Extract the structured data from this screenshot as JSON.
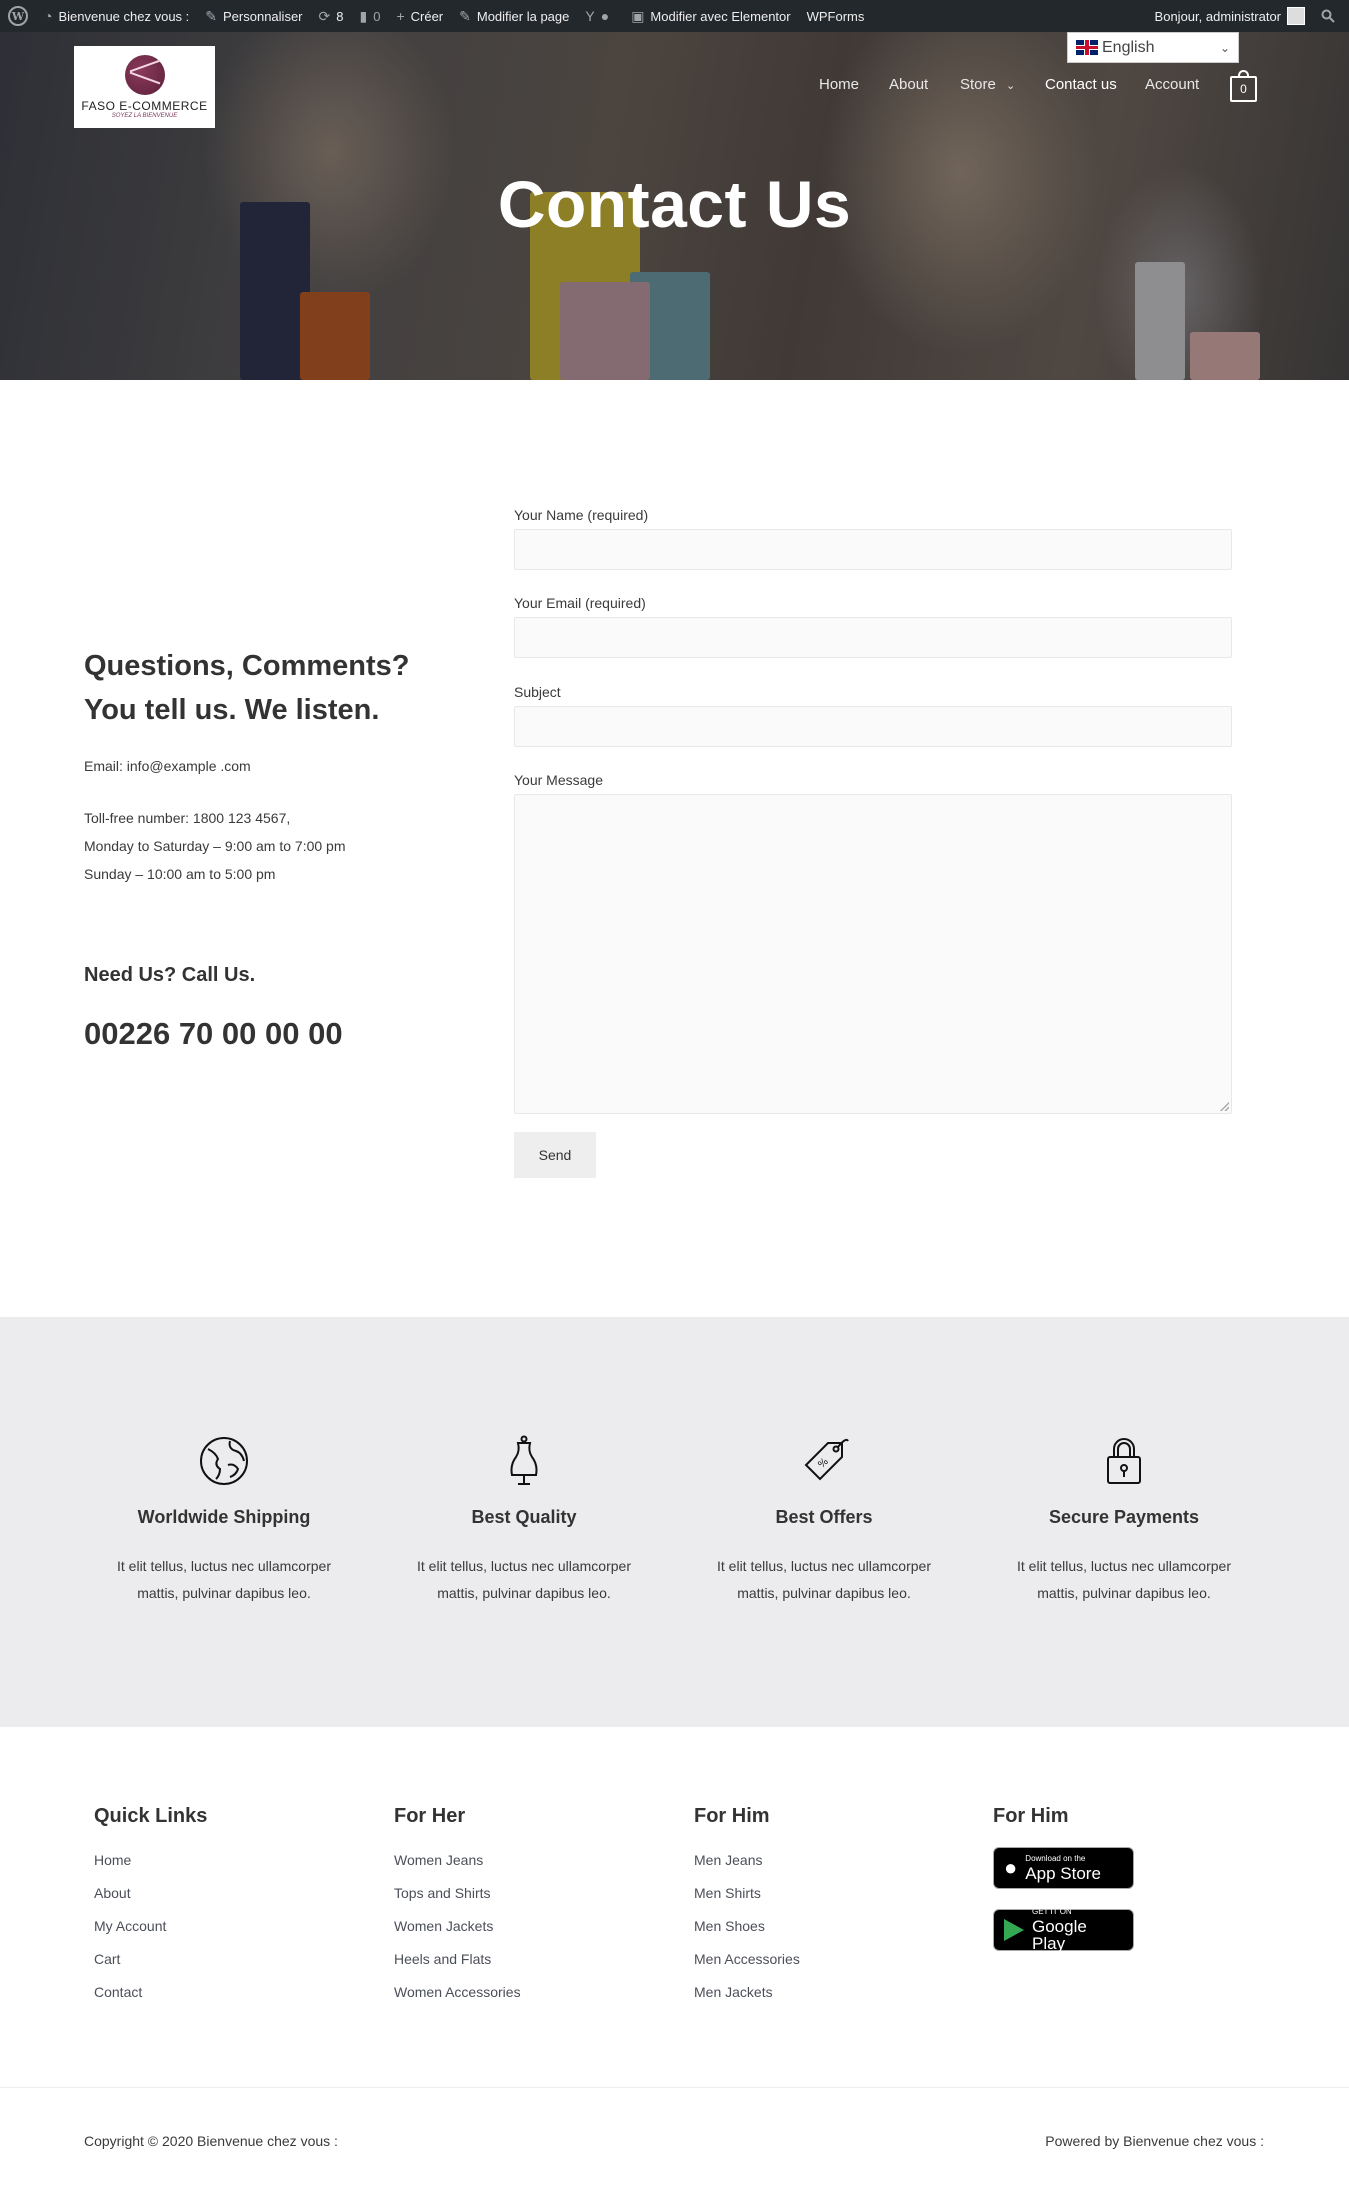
{
  "admin_bar": {
    "site_name": "Bienvenue chez vous :",
    "customize": "Personnaliser",
    "updates_count": "8",
    "comments_count": "0",
    "new": "Créer",
    "edit_page": "Modifier la page",
    "edit_elementor": "Modifier avec Elementor",
    "wpforms": "WPForms",
    "greeting": "Bonjour, administrator"
  },
  "header": {
    "logo_name": "FASO E-COMMERCE",
    "logo_tagline": "SOYEZ LA BIENVENUE",
    "language": "English",
    "nav": [
      {
        "label": "Home"
      },
      {
        "label": "About"
      },
      {
        "label": "Store"
      },
      {
        "label": "Contact us"
      },
      {
        "label": "Account"
      }
    ],
    "cart_count": "0"
  },
  "hero": {
    "title": "Contact Us"
  },
  "contact_info": {
    "heading": "Questions, Comments? You tell us. We listen.",
    "email": "Email: info@example .com",
    "tollfree": "Toll-free number: 1800 123 4567,",
    "weekdays": "Monday to Saturday – 9:00 am to 7:00 pm",
    "sunday": "Sunday – 10:00 am to 5:00 pm",
    "call_heading": "Need Us? Call Us.",
    "phone": "00226 70 00 00 00"
  },
  "form": {
    "name_label": "Your Name (required)",
    "email_label": "Your Email (required)",
    "subject_label": "Subject",
    "message_label": "Your Message",
    "name_value": "",
    "email_value": "",
    "subject_value": "",
    "message_value": "",
    "send_label": "Send"
  },
  "features": [
    {
      "icon": "globe-icon",
      "title": "Worldwide Shipping",
      "line1": "It elit tellus, luctus nec ullamcorper",
      "line2": "mattis, pulvinar dapibus leo."
    },
    {
      "icon": "dress-form-icon",
      "title": "Best Quality",
      "line1": "It elit tellus, luctus nec ullamcorper",
      "line2": "mattis, pulvinar dapibus leo."
    },
    {
      "icon": "price-tag-icon",
      "title": "Best Offers",
      "line1": "It elit tellus, luctus nec ullamcorper",
      "line2": "mattis, pulvinar dapibus leo."
    },
    {
      "icon": "padlock-icon",
      "title": "Secure Payments",
      "line1": "It elit tellus, luctus nec ullamcorper",
      "line2": "mattis, pulvinar dapibus leo."
    }
  ],
  "footer": {
    "quick_links": {
      "title": "Quick Links",
      "links": [
        "Home",
        "About",
        "My Account",
        "Cart",
        "Contact"
      ]
    },
    "for_her": {
      "title": "For Her",
      "links": [
        "Women Jeans",
        "Tops and Shirts",
        "Women Jackets",
        "Heels and Flats",
        "Women Accessories"
      ]
    },
    "for_him": {
      "title": "For Him",
      "links": [
        "Men Jeans",
        "Men Shirts",
        "Men Shoes",
        "Men Accessories",
        "Men Jackets"
      ]
    },
    "apps": {
      "title": "For Him",
      "app_store_small": "Download on the",
      "app_store_big": "App Store",
      "google_small": "GET IT ON",
      "google_big": "Google Play"
    },
    "copyright": "Copyright © 2020 Bienvenue chez vous :",
    "powered": "Powered by Bienvenue chez vous :"
  },
  "colors": {
    "admin_bar_bg": "#23282d",
    "features_bg": "#ececee",
    "button_bg": "#eeeeee",
    "input_bg": "#fafafa"
  }
}
